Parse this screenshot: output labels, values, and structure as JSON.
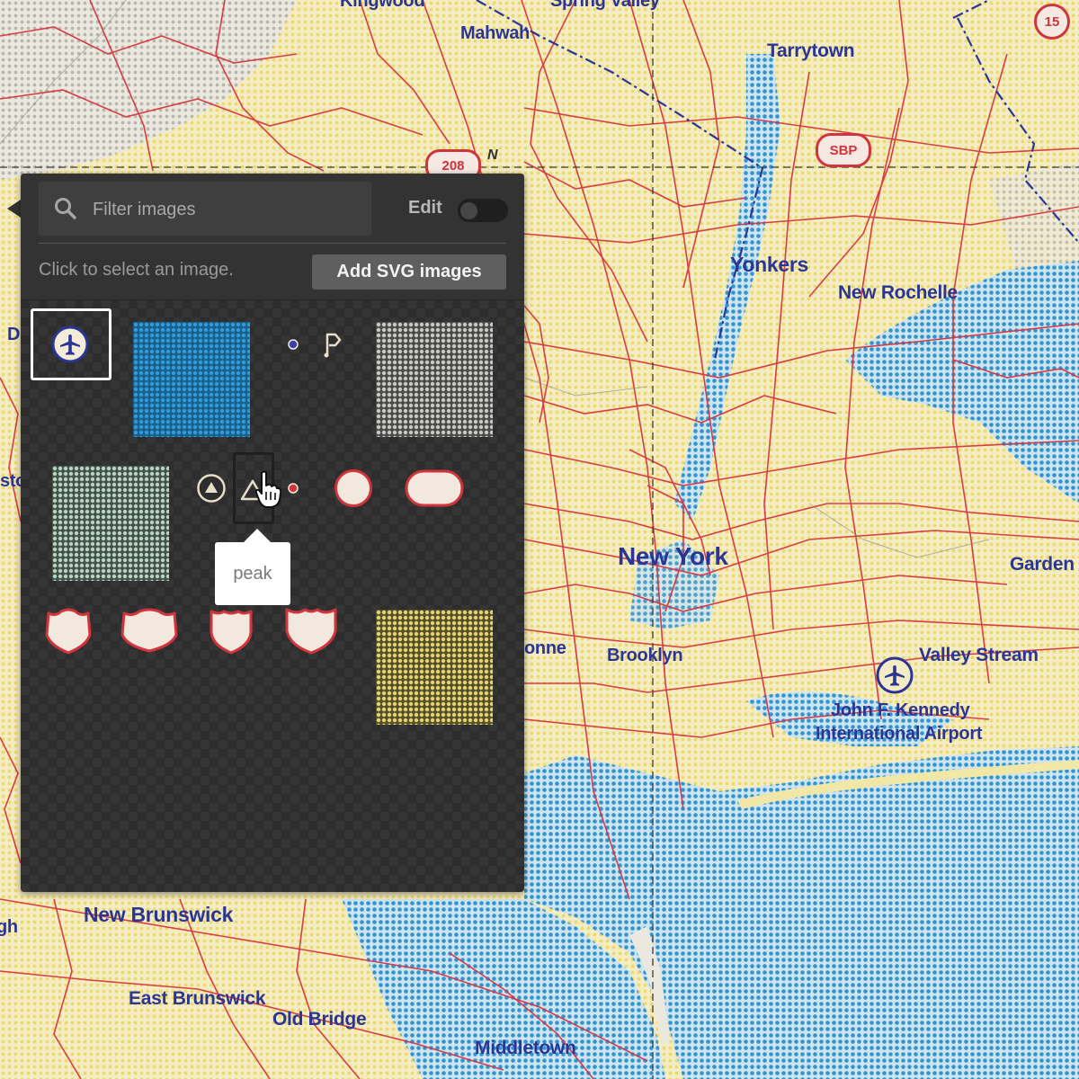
{
  "map": {
    "labels": [
      {
        "id": "kingwood",
        "text": "Kingwood",
        "size": 20
      },
      {
        "id": "spring-valley",
        "text": "Spring Valley",
        "size": 20
      },
      {
        "id": "mahwah",
        "text": "Mahwah",
        "size": 20
      },
      {
        "id": "tarrytown",
        "text": "Tarrytown",
        "size": 21
      },
      {
        "id": "yonkers",
        "text": "Yonkers",
        "size": 23
      },
      {
        "id": "new-rochelle",
        "text": "New Rochelle",
        "size": 21
      },
      {
        "id": "new-york",
        "text": "New York",
        "size": 28
      },
      {
        "id": "brooklyn",
        "text": "Brooklyn",
        "size": 20
      },
      {
        "id": "garden",
        "text": "Garden C",
        "size": 21
      },
      {
        "id": "valley-stream",
        "text": "Valley Stream",
        "size": 21
      },
      {
        "id": "jfk-1",
        "text": "John F. Kennedy",
        "size": 20
      },
      {
        "id": "jfk-2",
        "text": "International Airport",
        "size": 20
      },
      {
        "id": "onne",
        "text": "onne",
        "size": 20
      },
      {
        "id": "new-brunswick",
        "text": "New Brunswick",
        "size": 23
      },
      {
        "id": "east-brunswick",
        "text": "East Brunswick",
        "size": 21
      },
      {
        "id": "old-bridge",
        "text": "Old Bridge",
        "size": 21
      },
      {
        "id": "middletown",
        "text": "Middletown",
        "size": 21
      },
      {
        "id": "gh",
        "text": "gh",
        "size": 20
      },
      {
        "id": "d",
        "text": "D",
        "size": 20
      },
      {
        "id": "sto",
        "text": "sto",
        "size": 20
      }
    ],
    "shields": {
      "s15": "15",
      "s208": "208",
      "sbp": "SBP"
    },
    "compass_letter": "N",
    "colors": {
      "road": "#d7343f",
      "water": "#3a9ad1",
      "land": "#f1e8a8",
      "label": "#2b3595",
      "border": "#2b3595"
    }
  },
  "panel": {
    "search": {
      "placeholder": "Filter images",
      "value": ""
    },
    "edit_label": "Edit",
    "edit_toggle_on": false,
    "hint": "Click to select an image.",
    "add_button": "Add SVG images",
    "tooltip": "peak",
    "thumbnails": [
      {
        "icon": "airport-icon",
        "selected": true
      },
      {
        "icon": "water-pattern"
      },
      {
        "icon": "dot-blue-icon"
      },
      {
        "icon": "flag-icon"
      },
      {
        "icon": "gray-pattern"
      },
      {
        "icon": "green-pattern"
      },
      {
        "icon": "peak-circle-icon"
      },
      {
        "icon": "peak-icon",
        "hovered": true
      },
      {
        "icon": "dot-red-icon"
      },
      {
        "icon": "circle-shield-icon"
      },
      {
        "icon": "oval-shield-icon"
      },
      {
        "icon": "us-shield-wide-icon"
      },
      {
        "icon": "us-shield-wider-icon"
      },
      {
        "icon": "us-shield-narrow-icon"
      },
      {
        "icon": "us-shield-icon"
      },
      {
        "icon": "yellow-pattern"
      }
    ]
  }
}
